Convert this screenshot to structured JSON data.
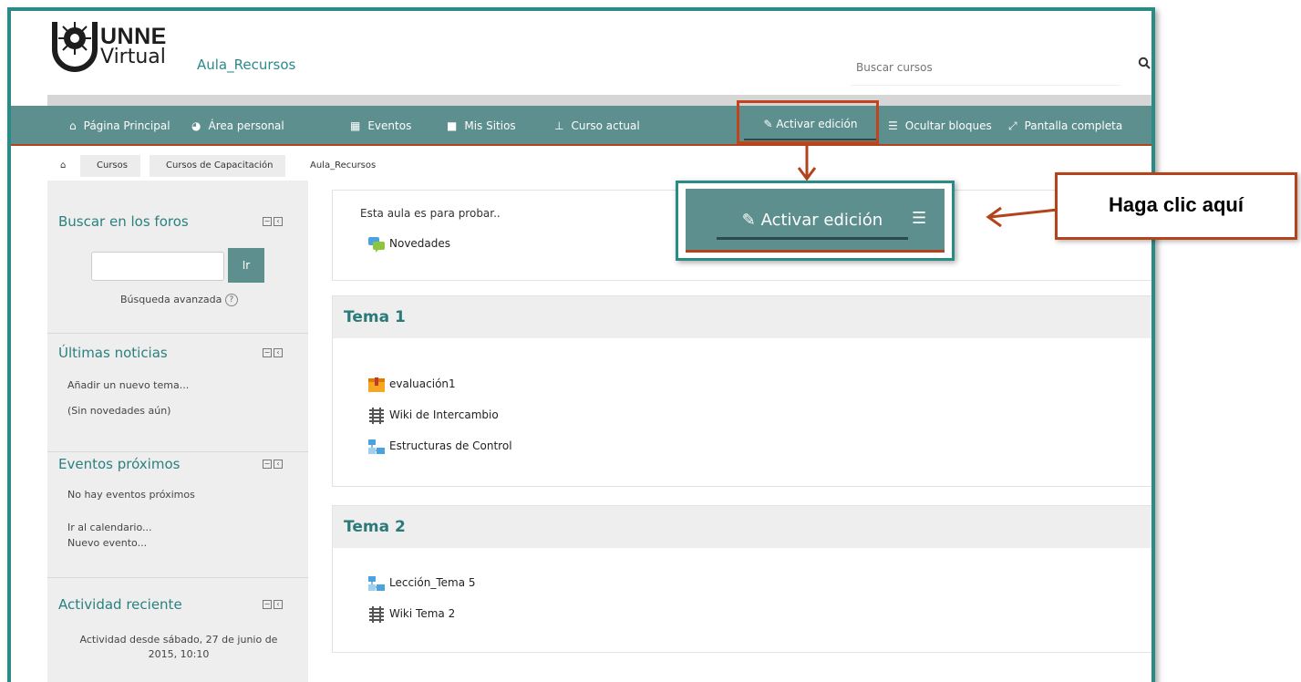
{
  "header": {
    "logo_top": "UNNE",
    "logo_bottom": "Virtual",
    "site_name": "Aula_Recursos",
    "search_placeholder": "Buscar cursos",
    "search_icon": "search-icon"
  },
  "nav": {
    "items": [
      {
        "label": "Página Principal",
        "icon": "home-icon"
      },
      {
        "label": "Área personal",
        "icon": "dashboard-icon"
      },
      {
        "label": "Eventos",
        "icon": "calendar-icon"
      },
      {
        "label": "Mis Sitios",
        "icon": "briefcase-icon"
      },
      {
        "label": "Curso actual",
        "icon": "sitemap-icon"
      }
    ],
    "edit_label": "Activar edición",
    "hide_blocks_label": "Ocultar bloques",
    "fullscreen_label": "Pantalla completa"
  },
  "breadcrumb": [
    "Cursos",
    "Cursos de Capacitación",
    "Aula_Recursos"
  ],
  "sidebar": {
    "forums": {
      "title": "Buscar en los foros",
      "button": "Ir",
      "advanced": "Búsqueda avanzada"
    },
    "news": {
      "title": "Últimas noticias",
      "add": "Añadir un nuevo tema...",
      "empty": "(Sin novedades aún)"
    },
    "events": {
      "title": "Eventos próximos",
      "empty": "No hay eventos próximos",
      "calendar": "Ir al calendario...",
      "new_event": "Nuevo evento..."
    },
    "recent": {
      "title": "Actividad reciente",
      "since": "Actividad desde sábado, 27 de junio de 2015, 10:10"
    }
  },
  "main": {
    "intro": "Esta aula es para probar..",
    "news_forum": "Novedades",
    "sections": [
      {
        "title": "Tema 1",
        "activities": [
          "evaluación1",
          "Wiki de Intercambio",
          "Estructuras de Control"
        ]
      },
      {
        "title": "Tema 2",
        "activities": [
          "Lección_Tema 5",
          "Wiki Tema 2"
        ]
      }
    ]
  },
  "annotation": {
    "zoom_label": "Activar edición",
    "callout": "Haga clic aquí"
  },
  "colors": {
    "nav": "#5d8f8e",
    "accent": "#2b8080",
    "highlight": "#c1441c",
    "frame": "#2a8a86"
  }
}
